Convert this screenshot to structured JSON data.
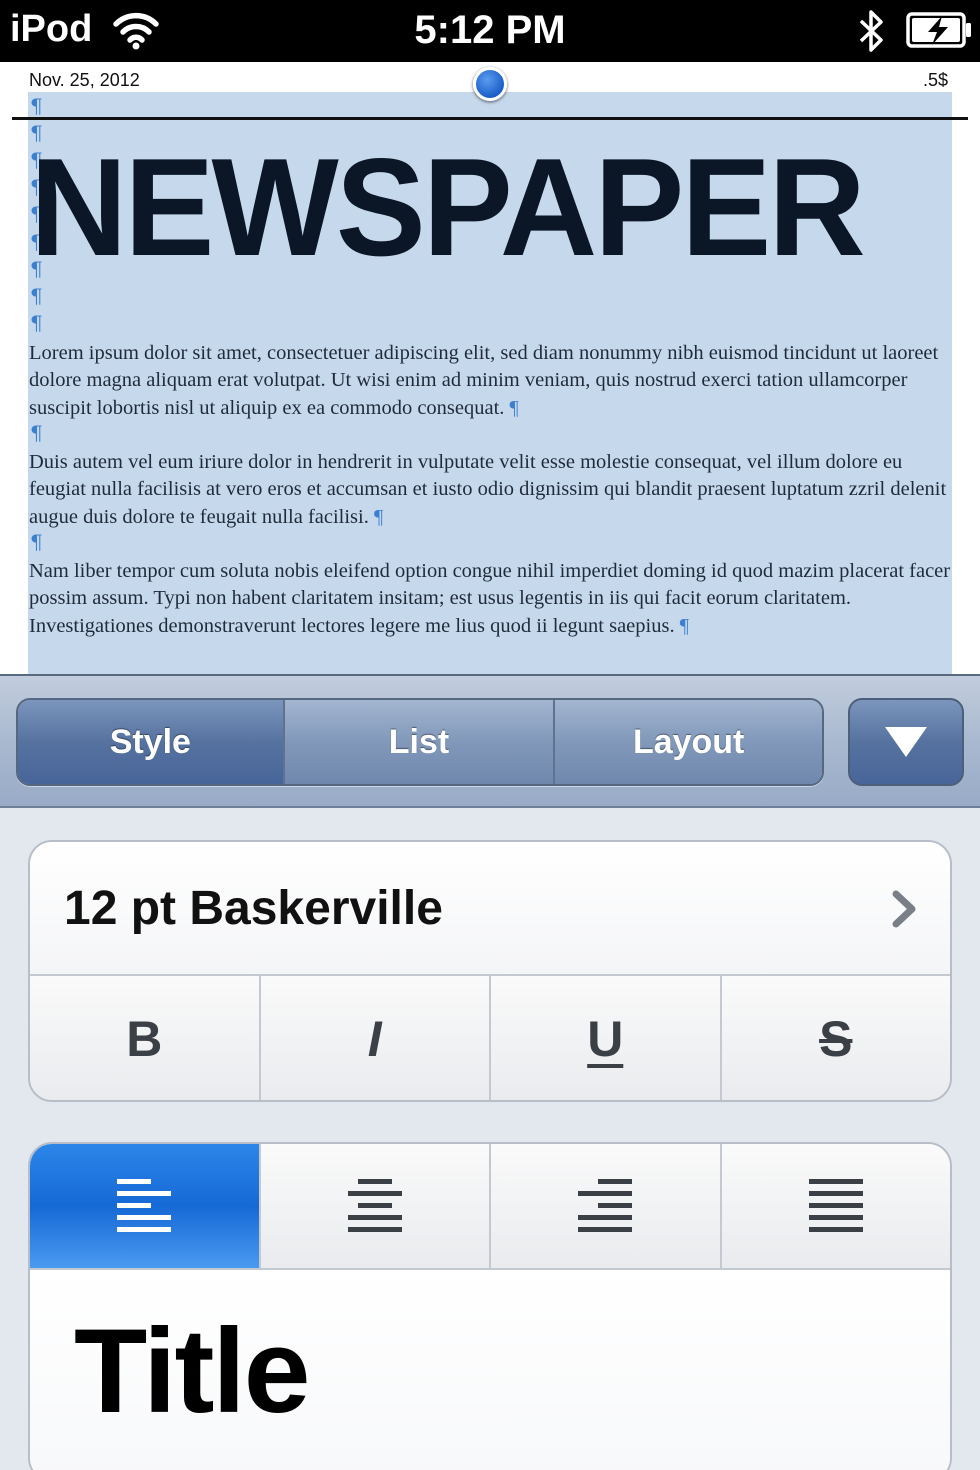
{
  "status_bar": {
    "carrier": "iPod",
    "time": "5:12 PM",
    "icons": [
      "wifi-icon",
      "bluetooth-icon",
      "battery-charging-icon"
    ]
  },
  "document": {
    "header_date": "Nov. 25, 2012",
    "header_right": ".5$",
    "pilcrow": "¶",
    "masthead": "NEWSPAPER",
    "paragraphs": [
      "Lorem ipsum dolor sit amet, consectetuer adipiscing elit, sed diam nonummy nibh euismod tincidunt ut laoreet dolore magna aliquam erat volutpat. Ut wisi enim ad minim veniam, quis nostrud exerci tation ullamcorper suscipit lobortis nisl ut aliquip ex ea commodo consequat.",
      "Duis autem vel eum iriure dolor in hendrerit in vulputate velit esse molestie consequat, vel illum dolore eu feugiat nulla facilisis at vero eros et accumsan et iusto odio dignissim qui blandit praesent luptatum zzril delenit augue duis dolore te feugait nulla facilisi.",
      "Nam liber tempor cum soluta nobis eleifend option congue nihil imperdiet doming id quod mazim placerat facer possim assum. Typi non habent claritatem insitam; est usus legentis in iis qui facit eorum claritatem. Investigationes demonstraverunt lectores legere me lius quod ii legunt saepius."
    ],
    "selection_color": "#c6d8ec"
  },
  "toolbar": {
    "tabs": [
      {
        "label": "Style",
        "active": true
      },
      {
        "label": "List",
        "active": false
      },
      {
        "label": "Layout",
        "active": false
      }
    ],
    "dropdown_icon": "triangle-down-icon"
  },
  "style_panel": {
    "font_label": "12 pt Baskerville",
    "format_buttons": [
      "B",
      "I",
      "U",
      "S"
    ],
    "alignment_buttons": [
      "align-left-icon",
      "align-center-icon",
      "align-right-icon",
      "align-justify-icon"
    ],
    "active_alignment": "align-left-icon",
    "paragraph_style": "Title",
    "accent_color": "#1669d6"
  }
}
